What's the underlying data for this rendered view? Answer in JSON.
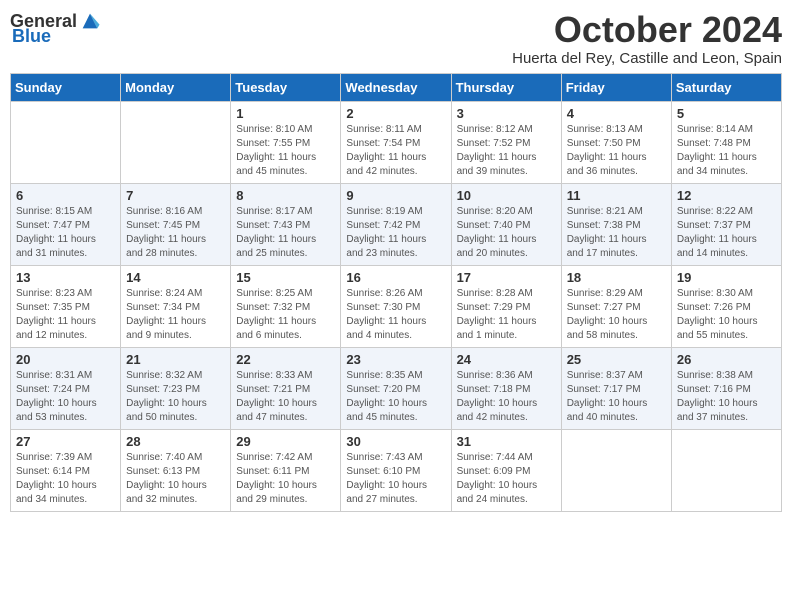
{
  "header": {
    "logo_general": "General",
    "logo_blue": "Blue",
    "month_title": "October 2024",
    "location": "Huerta del Rey, Castille and Leon, Spain"
  },
  "days_of_week": [
    "Sunday",
    "Monday",
    "Tuesday",
    "Wednesday",
    "Thursday",
    "Friday",
    "Saturday"
  ],
  "weeks": [
    [
      {
        "day": "",
        "info": ""
      },
      {
        "day": "",
        "info": ""
      },
      {
        "day": "1",
        "info": "Sunrise: 8:10 AM\nSunset: 7:55 PM\nDaylight: 11 hours and 45 minutes."
      },
      {
        "day": "2",
        "info": "Sunrise: 8:11 AM\nSunset: 7:54 PM\nDaylight: 11 hours and 42 minutes."
      },
      {
        "day": "3",
        "info": "Sunrise: 8:12 AM\nSunset: 7:52 PM\nDaylight: 11 hours and 39 minutes."
      },
      {
        "day": "4",
        "info": "Sunrise: 8:13 AM\nSunset: 7:50 PM\nDaylight: 11 hours and 36 minutes."
      },
      {
        "day": "5",
        "info": "Sunrise: 8:14 AM\nSunset: 7:48 PM\nDaylight: 11 hours and 34 minutes."
      }
    ],
    [
      {
        "day": "6",
        "info": "Sunrise: 8:15 AM\nSunset: 7:47 PM\nDaylight: 11 hours and 31 minutes."
      },
      {
        "day": "7",
        "info": "Sunrise: 8:16 AM\nSunset: 7:45 PM\nDaylight: 11 hours and 28 minutes."
      },
      {
        "day": "8",
        "info": "Sunrise: 8:17 AM\nSunset: 7:43 PM\nDaylight: 11 hours and 25 minutes."
      },
      {
        "day": "9",
        "info": "Sunrise: 8:19 AM\nSunset: 7:42 PM\nDaylight: 11 hours and 23 minutes."
      },
      {
        "day": "10",
        "info": "Sunrise: 8:20 AM\nSunset: 7:40 PM\nDaylight: 11 hours and 20 minutes."
      },
      {
        "day": "11",
        "info": "Sunrise: 8:21 AM\nSunset: 7:38 PM\nDaylight: 11 hours and 17 minutes."
      },
      {
        "day": "12",
        "info": "Sunrise: 8:22 AM\nSunset: 7:37 PM\nDaylight: 11 hours and 14 minutes."
      }
    ],
    [
      {
        "day": "13",
        "info": "Sunrise: 8:23 AM\nSunset: 7:35 PM\nDaylight: 11 hours and 12 minutes."
      },
      {
        "day": "14",
        "info": "Sunrise: 8:24 AM\nSunset: 7:34 PM\nDaylight: 11 hours and 9 minutes."
      },
      {
        "day": "15",
        "info": "Sunrise: 8:25 AM\nSunset: 7:32 PM\nDaylight: 11 hours and 6 minutes."
      },
      {
        "day": "16",
        "info": "Sunrise: 8:26 AM\nSunset: 7:30 PM\nDaylight: 11 hours and 4 minutes."
      },
      {
        "day": "17",
        "info": "Sunrise: 8:28 AM\nSunset: 7:29 PM\nDaylight: 11 hours and 1 minute."
      },
      {
        "day": "18",
        "info": "Sunrise: 8:29 AM\nSunset: 7:27 PM\nDaylight: 10 hours and 58 minutes."
      },
      {
        "day": "19",
        "info": "Sunrise: 8:30 AM\nSunset: 7:26 PM\nDaylight: 10 hours and 55 minutes."
      }
    ],
    [
      {
        "day": "20",
        "info": "Sunrise: 8:31 AM\nSunset: 7:24 PM\nDaylight: 10 hours and 53 minutes."
      },
      {
        "day": "21",
        "info": "Sunrise: 8:32 AM\nSunset: 7:23 PM\nDaylight: 10 hours and 50 minutes."
      },
      {
        "day": "22",
        "info": "Sunrise: 8:33 AM\nSunset: 7:21 PM\nDaylight: 10 hours and 47 minutes."
      },
      {
        "day": "23",
        "info": "Sunrise: 8:35 AM\nSunset: 7:20 PM\nDaylight: 10 hours and 45 minutes."
      },
      {
        "day": "24",
        "info": "Sunrise: 8:36 AM\nSunset: 7:18 PM\nDaylight: 10 hours and 42 minutes."
      },
      {
        "day": "25",
        "info": "Sunrise: 8:37 AM\nSunset: 7:17 PM\nDaylight: 10 hours and 40 minutes."
      },
      {
        "day": "26",
        "info": "Sunrise: 8:38 AM\nSunset: 7:16 PM\nDaylight: 10 hours and 37 minutes."
      }
    ],
    [
      {
        "day": "27",
        "info": "Sunrise: 7:39 AM\nSunset: 6:14 PM\nDaylight: 10 hours and 34 minutes."
      },
      {
        "day": "28",
        "info": "Sunrise: 7:40 AM\nSunset: 6:13 PM\nDaylight: 10 hours and 32 minutes."
      },
      {
        "day": "29",
        "info": "Sunrise: 7:42 AM\nSunset: 6:11 PM\nDaylight: 10 hours and 29 minutes."
      },
      {
        "day": "30",
        "info": "Sunrise: 7:43 AM\nSunset: 6:10 PM\nDaylight: 10 hours and 27 minutes."
      },
      {
        "day": "31",
        "info": "Sunrise: 7:44 AM\nSunset: 6:09 PM\nDaylight: 10 hours and 24 minutes."
      },
      {
        "day": "",
        "info": ""
      },
      {
        "day": "",
        "info": ""
      }
    ]
  ]
}
